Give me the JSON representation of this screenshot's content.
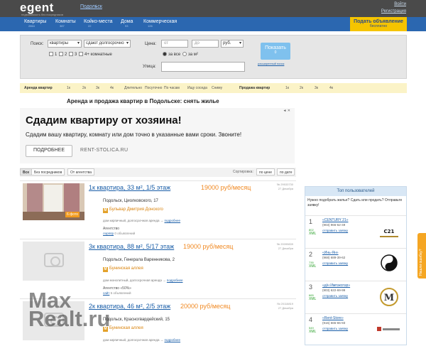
{
  "header": {
    "logo": "egent",
    "logo_sub": "недвижимость без посредников",
    "city": "Подольск",
    "city_caret": "↓",
    "login": "Войти",
    "register": "Регистрация"
  },
  "nav": [
    {
      "label": "Квартиры",
      "count": "2864"
    },
    {
      "label": "Комнаты",
      "count": "387"
    },
    {
      "label": "Койко-места",
      "count": "22"
    },
    {
      "label": "Дома",
      "count": "93"
    },
    {
      "label": "Коммерческая",
      "count": "126"
    }
  ],
  "post_ad": {
    "line1": "Подать объявление",
    "line2": "бесплатно"
  },
  "search": {
    "search_label": "Поиск:",
    "type_value": "квартиры",
    "term_value": "сдают долгосрочно",
    "rooms": [
      "1",
      "2",
      "3",
      "4+ комнатные"
    ],
    "price_label": "Цена:",
    "price_from_ph": "от",
    "price_to_ph": "до",
    "currency": "руб.",
    "per_all": "за все",
    "per_m2": "за м²",
    "street_label": "Улица:",
    "show_button": "Показать",
    "show_count": "0",
    "extended": "расширенный поиск"
  },
  "filters": [
    {
      "label": "Аренда квартир",
      "bold": true
    },
    {
      "label": "1к"
    },
    {
      "label": "2к"
    },
    {
      "label": "3к"
    },
    {
      "label": "4к"
    },
    {
      "label": "Длительно"
    },
    {
      "label": "Посуточно"
    },
    {
      "label": "По часам"
    },
    {
      "label": "Ищу соседа"
    },
    {
      "label": "Сниму"
    },
    {
      "label": "Продажа квартир",
      "bold": true
    },
    {
      "label": "1к"
    },
    {
      "label": "2к"
    },
    {
      "label": "3к"
    },
    {
      "label": "4к"
    }
  ],
  "headline": "Аренда и продажа квартир в Подольске: снять жилье",
  "ad": {
    "title": "Сдадим квартиру от хозяина!",
    "desc": "Сдадим вашу квартиру, комнату или дом точно в указанные вами сроки. Звоните!",
    "button": "ПОДРОБНЕЕ",
    "domain": "RENT-STOLICA.RU",
    "close": "◄ ✕"
  },
  "list_tabs": {
    "all": "Все",
    "no_agent": "Без посредников",
    "agency": "От агентства",
    "sort_label": "Сортировка:",
    "sort_price": "по цене",
    "sort_date": "по дате"
  },
  "listings": [
    {
      "title": "1к квартира, 33 м², 1/5 этаж",
      "price": "19000 руб/месяц",
      "number": "№ 29533730",
      "date": "27 Декабря",
      "address": "Подольск, Циолковского, 17",
      "metro": "Бульвар Дмитрия Донского",
      "type": "дом кирпичный, долгосрочная аренда",
      "details": "подробнее",
      "agency": "Агентство",
      "meta_link": "лорппр",
      "meta_rest": "0 объявлений",
      "photo_tag": "6 фото"
    },
    {
      "title": "3к квартира, 88 м², 5/17 этаж",
      "price": "19000 руб/месяц",
      "number": "№ 20099839",
      "date": "27 Декабря",
      "address": "Подольск, Генерала Варенникова, 2",
      "metro": "Бунинская аллея",
      "type": "дом монолитный, долгосрочная аренда",
      "details": "подробнее",
      "agency": "Агентство «50%»",
      "meta_link": "сайт",
      "meta_rest": "5 объявлений"
    },
    {
      "title": "2к квартира, 46 м², 2/5 этаж",
      "price": "20000 руб/месяц",
      "number": "№ 20116819",
      "date": "27 Декабря",
      "address": "Подольск, Красногвардейский, 15",
      "metro": "Бунинская аллея",
      "type": "дом кирпичный, долгосрочная аренда",
      "details": "подробнее"
    }
  ],
  "sidebar": {
    "title": "Топ пользователей",
    "question": "Нужно подобрать жилье? Сдать или продать? Отправьте заявку!",
    "users": [
      {
        "rank": "1",
        "score": "802",
        "xml": "XML",
        "name": "«CENTURY 21»",
        "phone": "(903) 966-62-49",
        "link": "отправить заявку",
        "logo": "CENTURY 21"
      },
      {
        "rank": "2",
        "score": "735",
        "xml": "XML",
        "name": "«Инь-Ян»",
        "phone": "(968) 689-39-62",
        "link": "отправить заявку",
        "logo": "Инь-Ян"
      },
      {
        "rank": "3",
        "score": "665",
        "xml": "XML",
        "name": "«д/н Импэкспэр»",
        "phone": "(903) 622-69-99",
        "link": "отправить заявку",
        "logo": "M"
      },
      {
        "rank": "4",
        "score": "549",
        "xml": "XML",
        "name": "«Rent-Store»",
        "phone": "(916) 665-65-93",
        "link": "отправить заявку",
        "logo": "Rent-Store"
      }
    ]
  },
  "feedback": "Нашли ошибку?",
  "watermark": {
    "line1": "Max",
    "line2": "Realt.ru"
  }
}
